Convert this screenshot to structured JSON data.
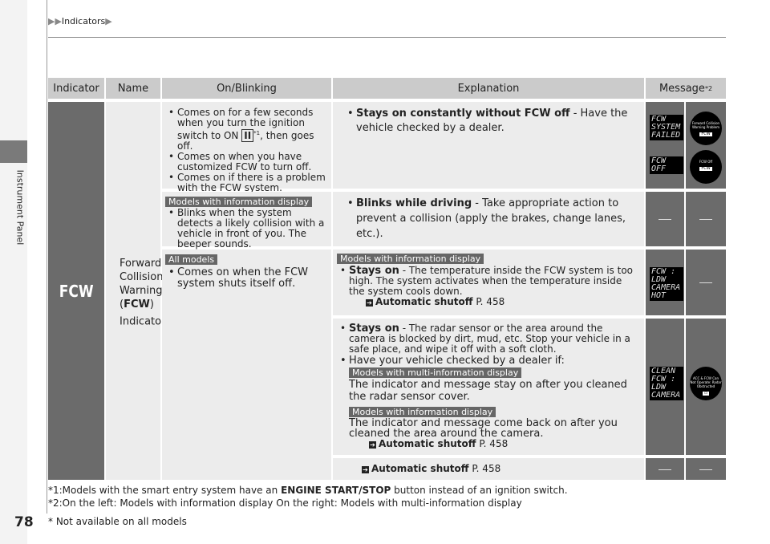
{
  "breadcrumb": {
    "items": [
      "Indicators"
    ]
  },
  "side_tab": "Instrument Panel",
  "page_number": "78",
  "table": {
    "headers": {
      "indicator": "Indicator",
      "name": "Name",
      "on_blinking": "On/Blinking",
      "explanation": "Explanation",
      "message": "Message",
      "message_sup": "*2"
    },
    "indicator_label": "FCW",
    "name": {
      "line1": "Forward",
      "line2": "Collision",
      "line3": "Warning",
      "line4_pre": "(",
      "line4_bold": "FCW",
      "line4_post": ")",
      "line5": "Indicator",
      "sup": "*"
    },
    "rows": [
      {
        "on": [
          "Comes on for a few seconds when you turn the ignition switch to ON",
          "Comes on when you have customized FCW to turn off.",
          "Comes on if there is a problem with the FCW system."
        ],
        "ignition_symbol": "II",
        "ignition_sup": "*1",
        "ignition_post": ", then goes off.",
        "exp_bold": "Stays on constantly without FCW off",
        "exp_text": " - Have the vehicle checked by a dealer.",
        "lcd1": [
          "FCW",
          "SYSTEM",
          "FAILED"
        ],
        "lcd2": [
          "FCW",
          "OFF"
        ],
        "gauge1": "Forward Collision Warning Problem",
        "gauge2": "FCW Off",
        "gauge_badge": "FCW"
      },
      {
        "on_tag": "Models with information display",
        "on": "Blinks when the system detects a likely collision with a vehicle in front of you. The beeper sounds.",
        "exp_bold": "Blinks while driving",
        "exp_text": " - Take appropriate action to prevent a collision (apply the brakes, change lanes, etc.)."
      },
      {
        "on_tag": "All models",
        "on": "Comes on when the FCW system shuts itself off.",
        "exp_tag": "Models with information display",
        "exp_bold": "Stays on",
        "exp_text": " - The temperature inside the FCW system is too high. The system activates when the temperature inside the system cools down.",
        "ref_bold": "Automatic shutoff",
        "ref_page": "P. 458",
        "lcd": [
          "FCW :",
          "LDW",
          "CAMERA",
          "HOT"
        ]
      },
      {
        "exp_bold": "Stays on",
        "exp_text": " - The radar sensor or the area around the camera is blocked by dirt, mud, etc. Stop your vehicle in a safe place, and wipe it off with a soft cloth.",
        "exp_bullet2": "Have your vehicle checked by a dealer if:",
        "tag_a": "Models with multi-information display",
        "text_a": "The indicator and message stay on after you cleaned the radar sensor cover.",
        "tag_b": "Models with information display",
        "text_b": "The indicator and message come back on after you cleaned the area around the camera.",
        "ref_bold": "Automatic shutoff",
        "ref_page": "P. 458",
        "lcd": [
          "CLEAN",
          "FCW :",
          "LDW",
          "CAMERA"
        ],
        "gauge": "ACC & FCW Can Not Operate: Radar Obstructed"
      },
      {
        "ref_bold": "Automatic shutoff",
        "ref_page": "P. 458"
      }
    ]
  },
  "footnotes": {
    "f1_pre": "*1:Models with the smart entry system have an ",
    "f1_bold": "ENGINE START/STOP",
    "f1_post": " button instead of an ignition switch.",
    "f2": "*2:On the left: Models with information display On the right: Models with multi-information display",
    "f3": "* Not available on all models"
  },
  "colors": {
    "header": "#cbcbcb",
    "cell": "#ececec",
    "dark": "#6b6b6b"
  }
}
